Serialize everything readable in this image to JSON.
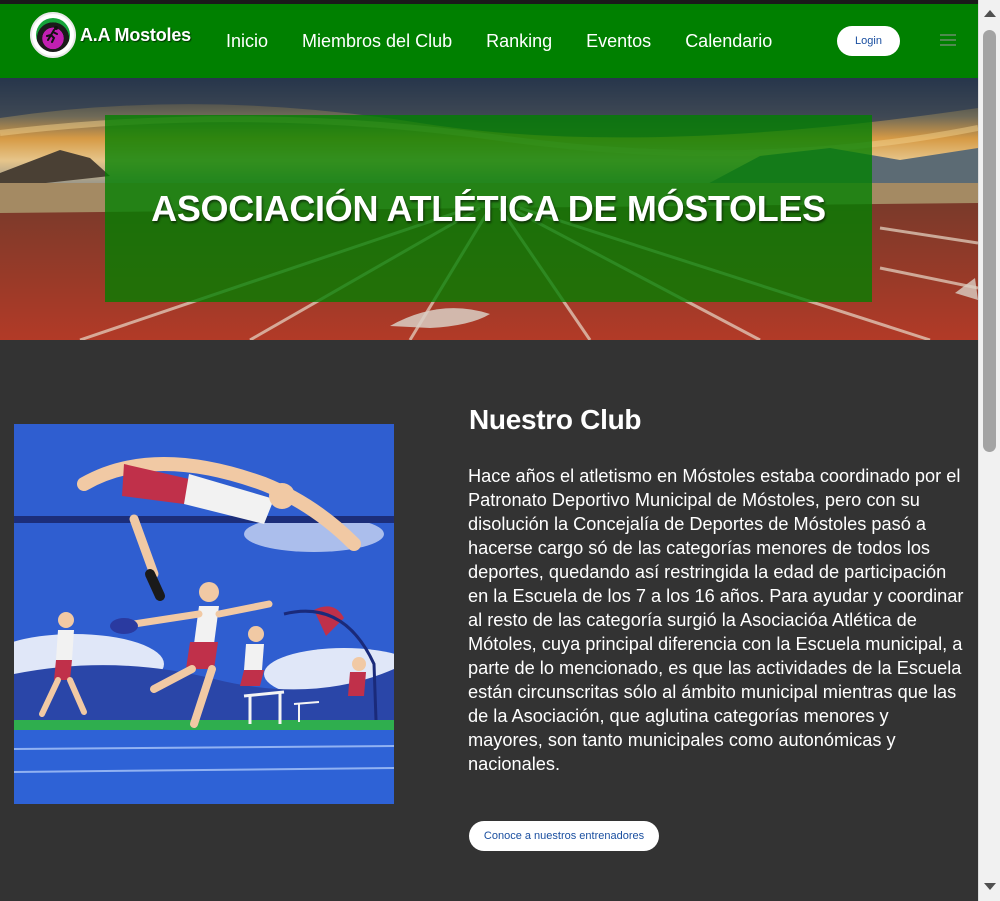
{
  "navbar": {
    "brand": "A.A Mostoles",
    "links": [
      "Inicio",
      "Miembros del Club",
      "Ranking",
      "Eventos",
      "Calendario"
    ],
    "login_label": "Login",
    "colors": {
      "background": "#008000",
      "button_text": "#1a4fa0"
    }
  },
  "hero": {
    "title": "ASOCIACIÓN ATLÉTICA DE MÓSTOLES"
  },
  "club": {
    "title": "Nuestro Club",
    "text": "Hace años el atletismo en Móstoles estaba coordinado por el Patronato Deportivo Municipal de Móstoles, pero con su disolución la Concejalía de Deportes de Móstoles pasó a hacerse cargo só de las categorías menores de todos los deportes, quedando así restringida la edad de participación en la Escuela de los 7 a los 16 años. Para ayudar y coordinar al resto de las categoría surgió la Asociacióa Atlética de Mótoles, cuya principal diferencia con la Escuela municipal, a parte de lo mencionado, es que las actividades de la Escuela están circunscritas sólo al ámbito municipal mientras que las de la Asociación, que aglutina categorías menores y mayores, son tanto municipales como autonómicas y nacionales.",
    "button_label": "Conoce a nuestros entrenadores"
  },
  "icons": [
    "club-logo-icon",
    "menu-icon",
    "scroll-up-icon",
    "scroll-down-icon"
  ]
}
